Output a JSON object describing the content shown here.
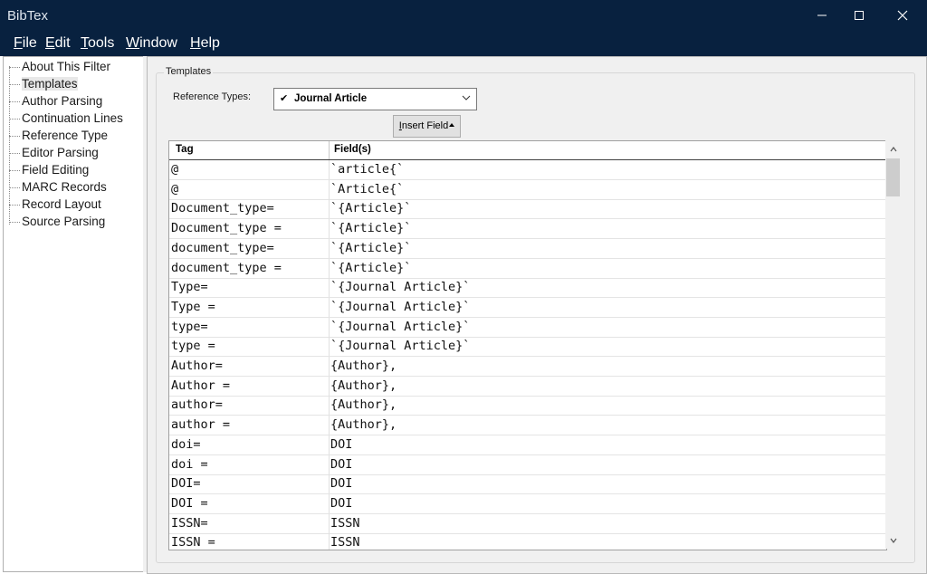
{
  "window": {
    "title": "BibTex",
    "controls": [
      "minimize-icon",
      "maximize-icon",
      "close-icon"
    ]
  },
  "menu": [
    {
      "label": "File",
      "mnemonic": "F",
      "rest": "ile"
    },
    {
      "label": "Edit",
      "mnemonic": "E",
      "rest": "dit"
    },
    {
      "label": "Tools",
      "mnemonic": "T",
      "rest": "ools"
    },
    {
      "label": "Window",
      "mnemonic": "W",
      "rest": "indow"
    },
    {
      "label": "Help",
      "mnemonic": "H",
      "rest": "elp"
    }
  ],
  "sidebar": {
    "items": [
      {
        "label": "About This Filter",
        "selected": false
      },
      {
        "label": "Templates",
        "selected": true
      },
      {
        "label": "Author Parsing",
        "selected": false
      },
      {
        "label": "Continuation Lines",
        "selected": false
      },
      {
        "label": "Reference Type",
        "selected": false
      },
      {
        "label": "Editor Parsing",
        "selected": false
      },
      {
        "label": "Field Editing",
        "selected": false
      },
      {
        "label": "MARC Records",
        "selected": false
      },
      {
        "label": "Record Layout",
        "selected": false
      },
      {
        "label": "Source Parsing",
        "selected": false
      }
    ]
  },
  "templates": {
    "group_title": "Templates",
    "reference_types_label": "Reference Types:",
    "reference_type_value": "Journal Article",
    "reference_type_check": "✔",
    "insert_field_mnemonic": "I",
    "insert_field_rest": "nsert Field",
    "table": {
      "headers": [
        "Tag",
        "Field(s)"
      ],
      "rows": [
        [
          "@",
          "`article{`"
        ],
        [
          "@",
          "`Article{`"
        ],
        [
          "Document_type=",
          "`{Article}`"
        ],
        [
          "Document_type =",
          "`{Article}`"
        ],
        [
          "document_type=",
          "`{Article}`"
        ],
        [
          "document_type =",
          "`{Article}`"
        ],
        [
          "Type=",
          "`{Journal Article}`"
        ],
        [
          "Type =",
          "`{Journal Article}`"
        ],
        [
          "type=",
          "`{Journal Article}`"
        ],
        [
          "type =",
          "`{Journal Article}`"
        ],
        [
          "Author=",
          "{Author},"
        ],
        [
          "Author =",
          "{Author},"
        ],
        [
          "author=",
          "{Author},"
        ],
        [
          "author =",
          "{Author},"
        ],
        [
          "doi=",
          "DOI"
        ],
        [
          "doi =",
          "DOI"
        ],
        [
          "DOI=",
          "DOI"
        ],
        [
          "DOI =",
          "DOI"
        ],
        [
          "ISSN=",
          "ISSN"
        ],
        [
          "ISSN =",
          "ISSN"
        ]
      ]
    }
  },
  "colors": {
    "titlebar": "#08213f",
    "panel": "#f0f0f0"
  }
}
